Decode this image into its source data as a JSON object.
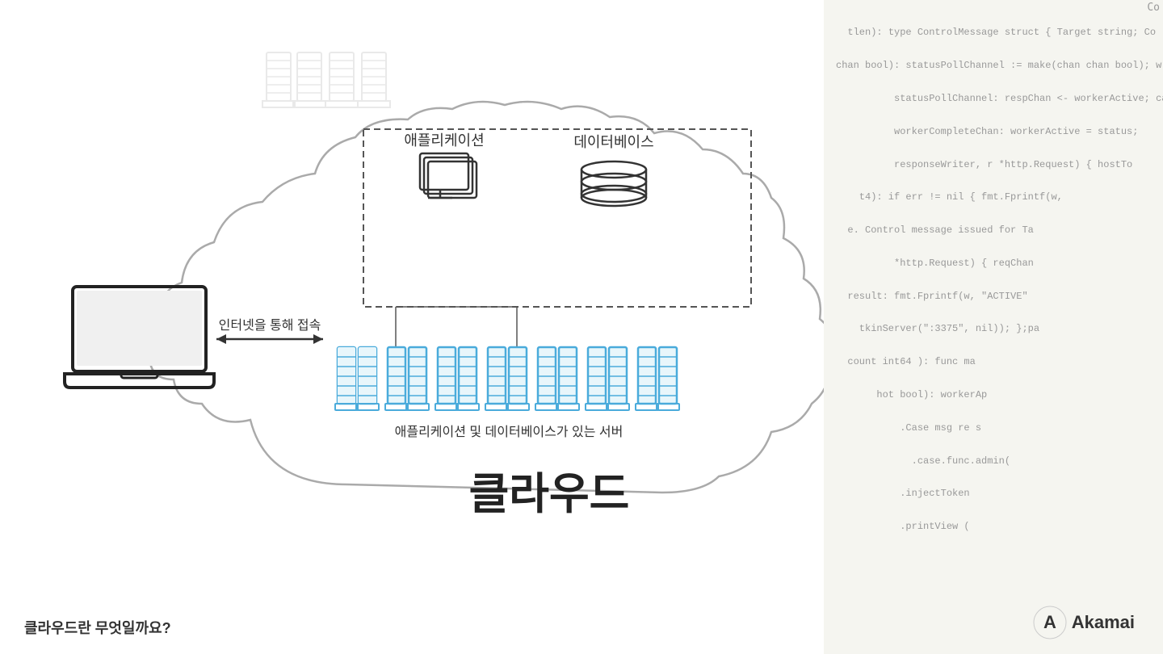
{
  "code": {
    "lines": [
      "tlen): type ControlMessage struct { Target string; Co",
      "chan bool): statusPollChannel := make(chan chan bool); w",
      "          statusPollChannel: respChan <- workerActive; case",
      "          workerCompleteChan: workerActive = status;",
      "          responseWriter, r *http.Request) { hostTo",
      "    t4): if err != nil { fmt.Fprintf(w,",
      "  e. Control message issued for Ta",
      "          *http.Request) { reqChan",
      "  result: fmt.Fprintf(w, \"ACTIVE\"",
      "    tkinServer(\":3375\", nil)); };pa",
      "  count int64 ): func ma",
      "       hot bool): workerAp",
      "           .Case msg re s",
      "             .case.func.admin(",
      "           .injectToken",
      "           .printView (",
      ""
    ]
  },
  "diagram": {
    "app_label": "애플리케이션",
    "db_label": "데이터베이스",
    "server_label": "애플리케이션 및 데이터베이스가 있는 서버",
    "cloud_title": "클라우드",
    "arrow_label": "인터넷을 통해 접속",
    "bottom_label": "클라우드란 무엇일까요?"
  },
  "akamai": {
    "label": "Akamai"
  }
}
